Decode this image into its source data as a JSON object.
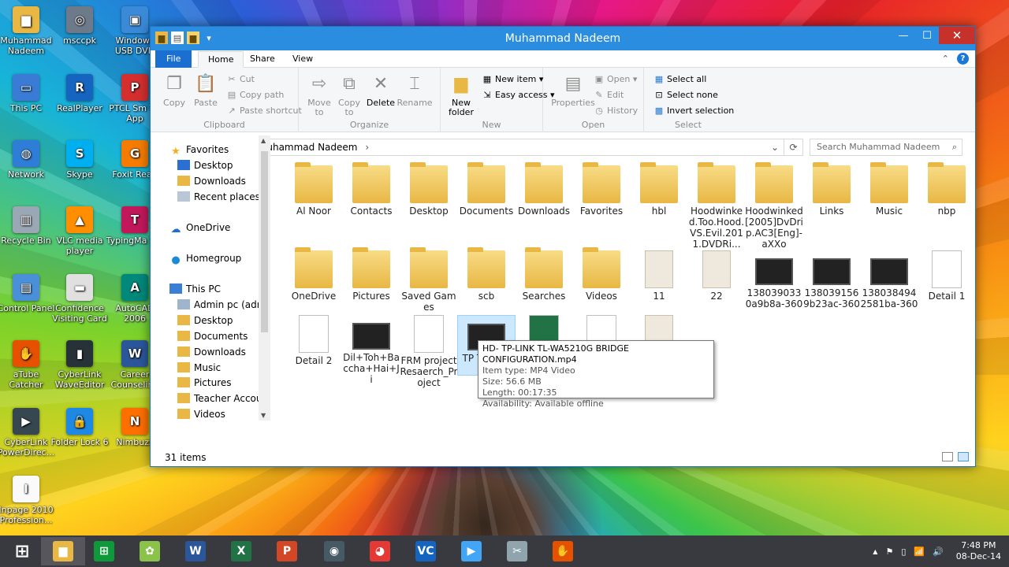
{
  "desktop": {
    "icons": [
      {
        "label": "Muhammad Nadeem",
        "color": "#e8b744",
        "glyph": "▆"
      },
      {
        "label": "msccpk",
        "color": "#6d7a8a",
        "glyph": "◎"
      },
      {
        "label": "Windows USB DVD",
        "color": "#3a8ad8",
        "glyph": "▣"
      },
      {
        "label": "This PC",
        "color": "#3a7bd5",
        "glyph": "▭"
      },
      {
        "label": "RealPlayer",
        "color": "#1565c0",
        "glyph": "R"
      },
      {
        "label": "PTCL Sm TV App",
        "color": "#d32f2f",
        "glyph": "P"
      },
      {
        "label": "Network",
        "color": "#2e7dd6",
        "glyph": "◍"
      },
      {
        "label": "Skype",
        "color": "#00aff0",
        "glyph": "S"
      },
      {
        "label": "Foxit Read",
        "color": "#f57c00",
        "glyph": "G"
      },
      {
        "label": "Recycle Bin",
        "color": "#9aa7b5",
        "glyph": "▥"
      },
      {
        "label": "VLC media player",
        "color": "#ff8f00",
        "glyph": "▲"
      },
      {
        "label": "TypingMa Pro",
        "color": "#c2185b",
        "glyph": "T"
      },
      {
        "label": "Control Panel",
        "color": "#4a90d9",
        "glyph": "▤"
      },
      {
        "label": "Confidence Visiting Card",
        "color": "#e0e0e0",
        "glyph": "▬"
      },
      {
        "label": "AutoCAD 2006",
        "color": "#00897b",
        "glyph": "A"
      },
      {
        "label": "aTube Catcher",
        "color": "#e65100",
        "glyph": "✋"
      },
      {
        "label": "CyberLink WaveEditor",
        "color": "#263238",
        "glyph": "▮"
      },
      {
        "label": "Career Counseling",
        "color": "#2b579a",
        "glyph": "W"
      },
      {
        "label": "CyberLink PowerDirec...",
        "color": "#37474f",
        "glyph": "▶"
      },
      {
        "label": "Folder Lock 6",
        "color": "#1e88e5",
        "glyph": "🔒"
      },
      {
        "label": "Nimbuzz",
        "color": "#ff6f00",
        "glyph": "N"
      },
      {
        "label": "Inpage 2010 Profession...",
        "color": "#fafafa",
        "glyph": "I"
      }
    ]
  },
  "window": {
    "title": "Muhammad Nadeem",
    "controls": {
      "minimize": "—",
      "maximize": "☐",
      "close": "✕"
    }
  },
  "ribbon_tabs": {
    "file": "File",
    "home": "Home",
    "share": "Share",
    "view": "View"
  },
  "ribbon": {
    "clipboard": {
      "label": "Clipboard",
      "copy": "Copy",
      "paste": "Paste",
      "cut": "Cut",
      "copy_path": "Copy path",
      "paste_shortcut": "Paste shortcut"
    },
    "organize": {
      "label": "Organize",
      "move_to": "Move to",
      "copy_to": "Copy to",
      "delete": "Delete",
      "rename": "Rename"
    },
    "new": {
      "label": "New",
      "new_folder": "New folder",
      "new_item": "New item",
      "easy_access": "Easy access"
    },
    "open": {
      "label": "Open",
      "properties": "Properties",
      "open": "Open",
      "edit": "Edit",
      "history": "History"
    },
    "select": {
      "label": "Select",
      "select_all": "Select all",
      "select_none": "Select none",
      "invert": "Invert selection"
    }
  },
  "address": {
    "path": "Muhammad Nadeem",
    "search_placeholder": "Search Muhammad Nadeem"
  },
  "nav": {
    "favorites": "Favorites",
    "desktop": "Desktop",
    "downloads": "Downloads",
    "recent": "Recent places",
    "onedrive": "OneDrive",
    "homegroup": "Homegroup",
    "thispc": "This PC",
    "admin": "Admin pc (admin",
    "desktop2": "Desktop",
    "documents": "Documents",
    "downloads2": "Downloads",
    "music": "Music",
    "pictures": "Pictures",
    "teacher": "Teacher Account",
    "videos": "Videos"
  },
  "items": [
    {
      "label": "Al Noor",
      "kind": "folder"
    },
    {
      "label": "Contacts",
      "kind": "folder"
    },
    {
      "label": "Desktop",
      "kind": "folder"
    },
    {
      "label": "Documents",
      "kind": "folder"
    },
    {
      "label": "Downloads",
      "kind": "folder"
    },
    {
      "label": "Favorites",
      "kind": "folder"
    },
    {
      "label": "hbl",
      "kind": "folder"
    },
    {
      "label": "Hoodwinked.Too.Hood.VS.Evil.2011.DVDRi...",
      "kind": "folder"
    },
    {
      "label": "Hoodwinked[2005]DvDrip.AC3[Eng]-aXXo",
      "kind": "folder"
    },
    {
      "label": "Links",
      "kind": "folder"
    },
    {
      "label": "Music",
      "kind": "folder"
    },
    {
      "label": "nbp",
      "kind": "folder"
    },
    {
      "label": "OneDrive",
      "kind": "folder"
    },
    {
      "label": "Pictures",
      "kind": "folder"
    },
    {
      "label": "Saved Games",
      "kind": "folder"
    },
    {
      "label": "scb",
      "kind": "folder"
    },
    {
      "label": "Searches",
      "kind": "folder"
    },
    {
      "label": "Videos",
      "kind": "folder"
    },
    {
      "label": "11",
      "kind": "img"
    },
    {
      "label": "22",
      "kind": "img"
    },
    {
      "label": "1380390330a9b8a-360",
      "kind": "vid"
    },
    {
      "label": "1380391569b23ac-360",
      "kind": "vid"
    },
    {
      "label": "1380384942581ba-360",
      "kind": "vid"
    },
    {
      "label": "Detail 1",
      "kind": "doc"
    },
    {
      "label": "Detail 2",
      "kind": "doc"
    },
    {
      "label": "Dil+Toh+Baccha+Hai+Ji",
      "kind": "vid"
    },
    {
      "label": "FRM project Resaerch_Project",
      "kind": "doc"
    },
    {
      "label": "TP TL-W G BR",
      "kind": "vid"
    },
    {
      "label": "",
      "kind": "xls"
    },
    {
      "label": "",
      "kind": "doc"
    },
    {
      "label": "",
      "kind": "img"
    }
  ],
  "tooltip": {
    "title": "HD- TP-LINK TL-WA5210G BRIDGE CONFIGURATION.mp4",
    "type": "Item type: MP4 Video",
    "size": "Size: 56.6 MB",
    "length": "Length: 00:17:35",
    "availability": "Availability: Available offline"
  },
  "status": {
    "count": "31 items"
  },
  "taskbar": {
    "apps": [
      {
        "name": "start",
        "glyph": "⊞",
        "color": "transparent"
      },
      {
        "name": "explorer",
        "glyph": "▆",
        "color": "#e8b744"
      },
      {
        "name": "store",
        "glyph": "⊞",
        "color": "#0e9a3a"
      },
      {
        "name": "app-green",
        "glyph": "✿",
        "color": "#8bc34a"
      },
      {
        "name": "word",
        "glyph": "W",
        "color": "#2b579a"
      },
      {
        "name": "excel",
        "glyph": "X",
        "color": "#217346"
      },
      {
        "name": "powerpoint",
        "glyph": "P",
        "color": "#d24726"
      },
      {
        "name": "media",
        "glyph": "◉",
        "color": "#455a64"
      },
      {
        "name": "chrome",
        "glyph": "◕",
        "color": "#e53935"
      },
      {
        "name": "vc",
        "glyph": "VC",
        "color": "#1565c0"
      },
      {
        "name": "screen",
        "glyph": "▶",
        "color": "#42a5f5"
      },
      {
        "name": "tool",
        "glyph": "✂",
        "color": "#90a4ae"
      },
      {
        "name": "atube",
        "glyph": "✋",
        "color": "#e65100"
      }
    ],
    "tray": {
      "up": "▲",
      "flag": "⚑",
      "battery": "▯",
      "network": "📶",
      "volume": "🔊"
    },
    "clock_time": "7:48 PM",
    "clock_date": "08-Dec-14"
  }
}
